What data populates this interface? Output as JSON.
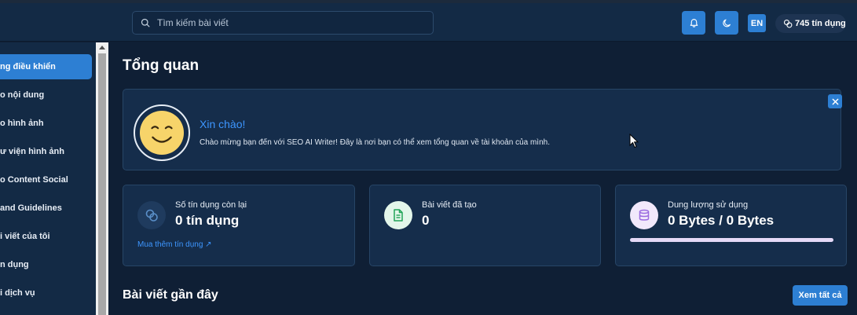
{
  "header": {
    "search_placeholder": "Tìm kiếm bài viết",
    "language": "EN",
    "credits": "745 tín dụng"
  },
  "sidebar": {
    "items": [
      {
        "label": "ng điều khiển",
        "active": true
      },
      {
        "label": "o nội dung",
        "active": false
      },
      {
        "label": "o hình ảnh",
        "active": false
      },
      {
        "label": "ư viện hình ảnh",
        "active": false
      },
      {
        "label": "o Content Social",
        "active": false
      },
      {
        "label": "and Guidelines",
        "active": false
      },
      {
        "label": "i viết của tôi",
        "active": false
      },
      {
        "label": "n dụng",
        "active": false
      },
      {
        "label": "i dịch vụ",
        "active": false
      }
    ]
  },
  "main": {
    "title": "Tổng quan",
    "welcome": {
      "greeting": "Xin chào!",
      "message": "Chào mừng bạn đến với SEO AI Writer! Đây là nơi bạn có thể xem tổng quan về tài khoản của mình."
    },
    "cards": [
      {
        "label": "Số tín dụng còn lại",
        "value": "0 tín dụng",
        "link": "Mua thêm tín dụng ↗",
        "icon": "coins-icon"
      },
      {
        "label": "Bài viết đã tạo",
        "value": "0",
        "icon": "document-icon"
      },
      {
        "label": "Dung lượng sử dụng",
        "value": "0 Bytes / 0 Bytes",
        "icon": "database-icon",
        "usage_fraction": 0
      }
    ],
    "recent_title": "Bài viết gần đây",
    "see_all": "Xem tất cả"
  },
  "colors": {
    "accent": "#2d7fd3",
    "link": "#3d96ff",
    "background": "#0f1f35",
    "card": "#152d4b"
  }
}
